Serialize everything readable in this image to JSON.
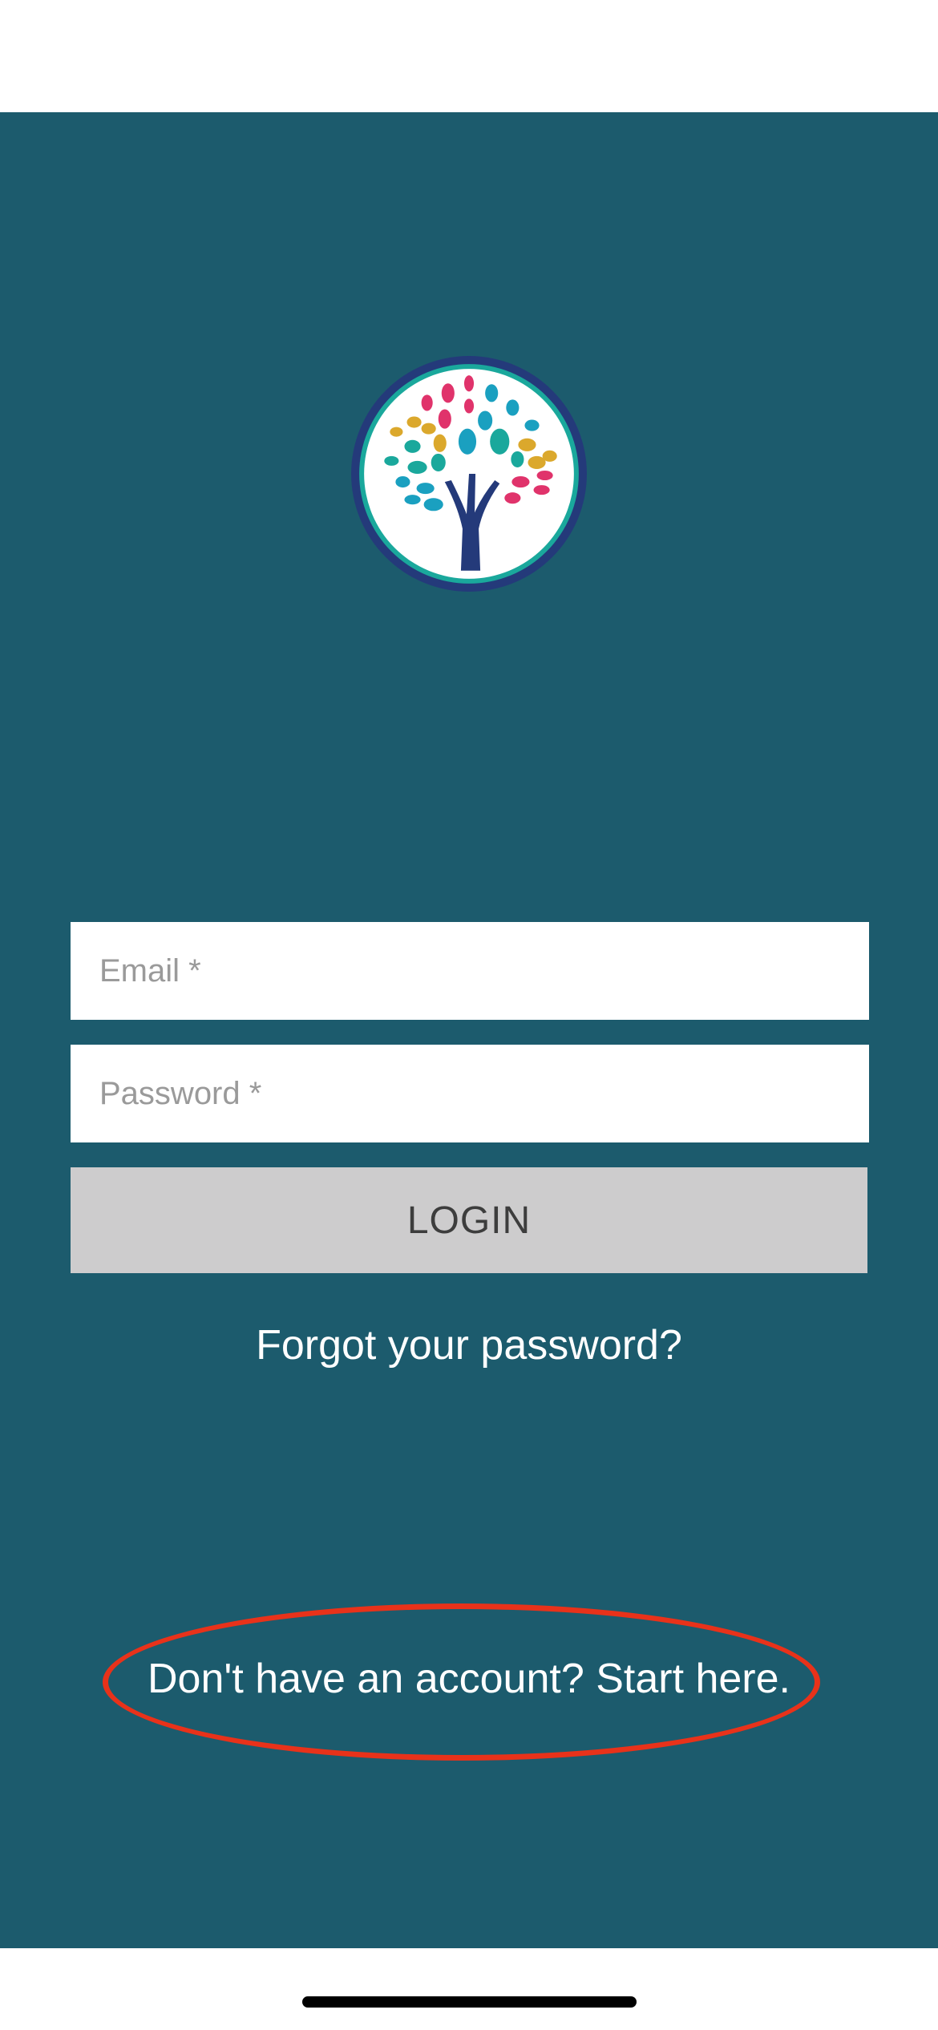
{
  "login": {
    "email_placeholder": "Email *",
    "password_placeholder": "Password *",
    "login_label": "LOGIN",
    "forgot_label": "Forgot your password?",
    "signup_label": "Don't have an account? Start here."
  },
  "colors": {
    "background": "#1c5b6d",
    "button": "#cdcccd",
    "highlight": "#e8321a"
  }
}
